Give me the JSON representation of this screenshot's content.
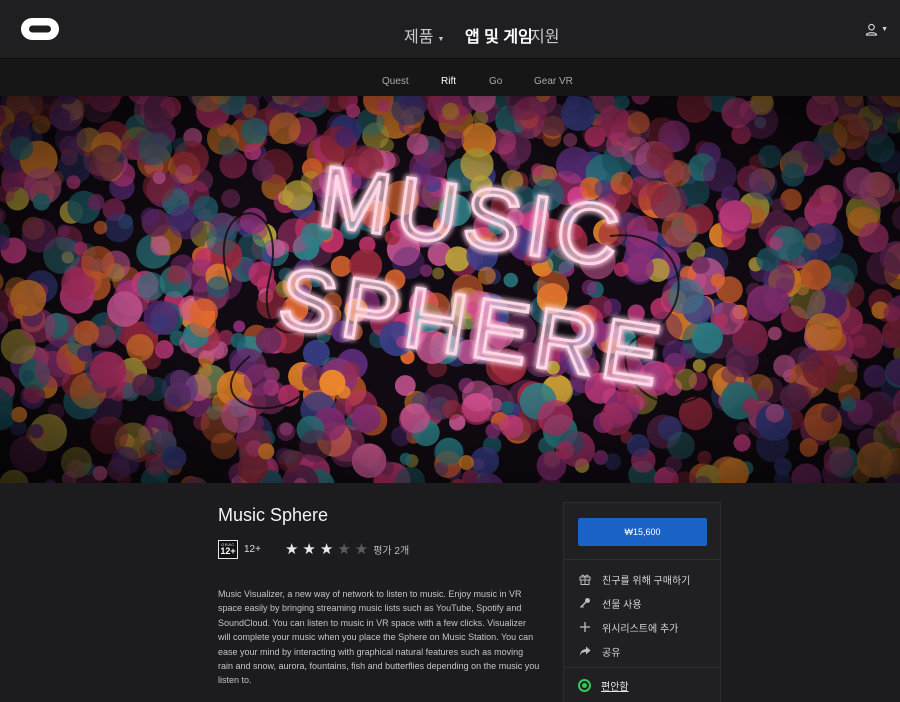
{
  "header": {
    "nav": [
      {
        "label": "제품",
        "has_caret": true
      },
      {
        "label": "앱 및 게임",
        "active": true
      },
      {
        "label": "지원"
      }
    ]
  },
  "subnav": {
    "items": [
      {
        "label": "Quest"
      },
      {
        "label": "Rift",
        "active": true
      },
      {
        "label": "Go"
      },
      {
        "label": "Gear VR"
      }
    ]
  },
  "hero": {
    "line1": "MUSIC",
    "line2": "SPHERE"
  },
  "product": {
    "title": "Music Sphere",
    "age_badge_top": "GRAC",
    "age_badge_num": "12+",
    "age_text": "12+",
    "stars_full": 3,
    "stars_total": 5,
    "rating_count": "평가 2개",
    "description": "Music Visualizer, a new way of network to listen to music. Enjoy music in VR space easily by bringing streaming music lists such as YouTube, Spotify and SoundCloud. You can listen to music in VR space with a few clicks. Visualizer will complete your music when you place the Sphere on Music Station. You can ease your mind by interacting with graphical natural features such as moving rain and snow, aurora, fountains, fish and butterflies depending on the music you listen to."
  },
  "purchase": {
    "price": "₩15,600",
    "actions": [
      {
        "label": "친구를 위해 구매하기",
        "icon": "gift-icon"
      },
      {
        "label": "선물 사용",
        "icon": "key-icon"
      },
      {
        "label": "위시리스트에 추가",
        "icon": "plus-icon"
      },
      {
        "label": "공유",
        "icon": "share-icon"
      }
    ],
    "comfort": "편안함"
  },
  "colors": {
    "buy_button": "#1b62c6",
    "comfort": "#34c759",
    "neon": "#ff6fa8"
  }
}
